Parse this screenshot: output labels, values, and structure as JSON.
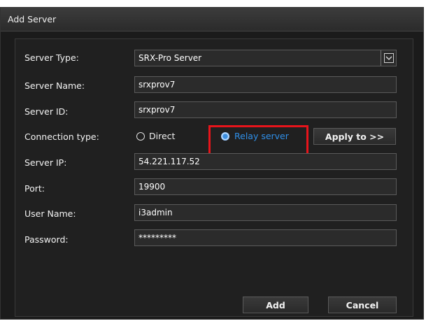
{
  "dialog": {
    "title": "Add Server"
  },
  "form": {
    "server_type": {
      "label": "Server Type:",
      "value": "SRX-Pro Server"
    },
    "server_name": {
      "label": "Server Name:",
      "value": "srxprov7"
    },
    "server_id": {
      "label": "Server ID:",
      "value": "srxprov7"
    },
    "connection_type": {
      "label": "Connection type:",
      "options": [
        "Direct",
        "Relay server"
      ],
      "selected": "Relay server"
    },
    "server_ip": {
      "label": "Server IP:",
      "value": "54.221.117.52"
    },
    "port": {
      "label": "Port:",
      "value": "19900"
    },
    "user_name": {
      "label": "User Name:",
      "value": "i3admin"
    },
    "password": {
      "label": "Password:",
      "value": "*********"
    }
  },
  "buttons": {
    "apply_to": "Apply to >>",
    "add": "Add",
    "cancel": "Cancel"
  },
  "colors": {
    "highlight": "#e8141b",
    "selected_radio_text": "#2f8fe8"
  }
}
